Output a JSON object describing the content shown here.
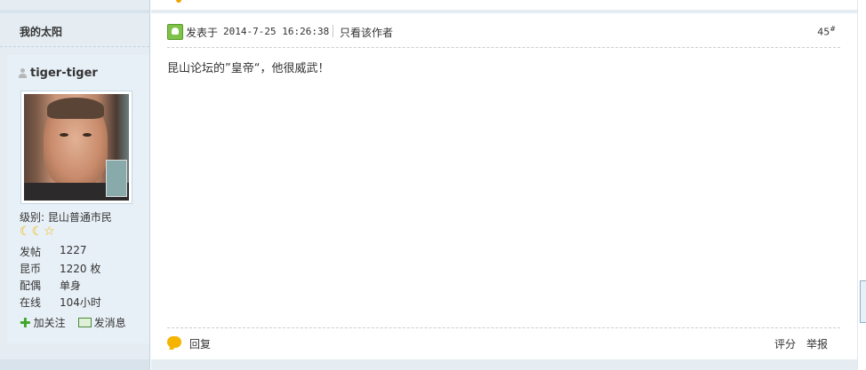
{
  "sidebar": {
    "title": "我的太阳",
    "username": "tiger-tiger",
    "level_label": "级别:",
    "level_value": "昆山普通市民",
    "stars": [
      "moon-icon",
      "moon-icon",
      "star-icon"
    ],
    "stats": [
      {
        "key": "发帖",
        "value": "1227"
      },
      {
        "key": "昆币",
        "value": "1220 枚"
      },
      {
        "key": "配偶",
        "value": "单身"
      },
      {
        "key": "在线",
        "value": "104小时"
      }
    ],
    "follow_label": "加关注",
    "message_label": "发消息"
  },
  "post": {
    "posted_label": "发表于",
    "time": "2014-7-25 16:26:38",
    "only_author_label": "只看该作者",
    "floor": "45",
    "floor_suffix": "#",
    "content": "昆山论坛的”皇帝“，他很威武！",
    "reply_label": "回复",
    "rate_label": "评分",
    "report_label": "举报"
  },
  "colors": {
    "sidebar_bg": "#e5edf2",
    "border": "#c2d5e3",
    "accent_orange": "#f5b400",
    "online_green": "#7ec24a"
  }
}
